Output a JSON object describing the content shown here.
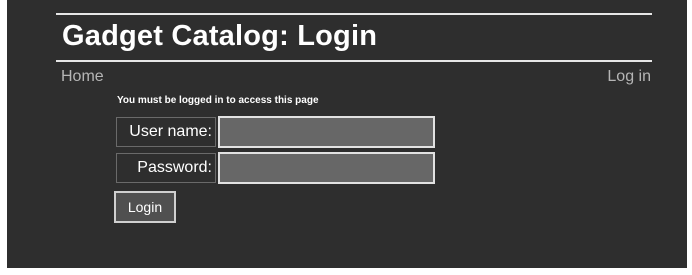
{
  "header": {
    "title": "Gadget Catalog: Login"
  },
  "nav": {
    "home_label": "Home",
    "login_label": "Log in"
  },
  "form": {
    "notice": "You must be logged in to access this page",
    "username_label": "User name:",
    "username_value": "",
    "password_label": "Password:",
    "password_value": "",
    "submit_label": "Login"
  }
}
